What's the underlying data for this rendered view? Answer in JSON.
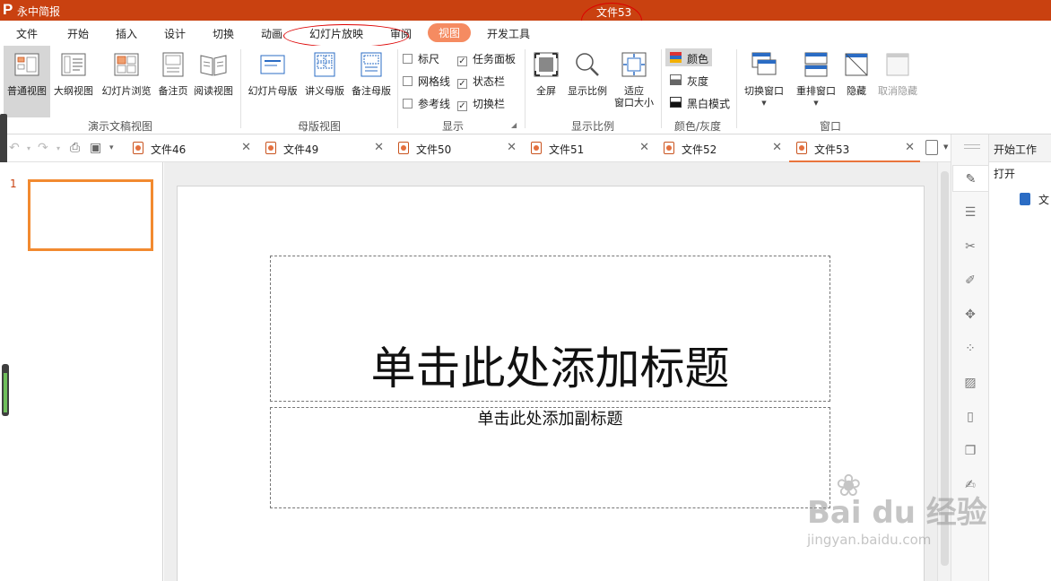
{
  "app": {
    "name": "永中简报",
    "logo_letter": "P",
    "document_title": "文件53"
  },
  "menu": [
    {
      "label": "文件",
      "name": "menu-file"
    },
    {
      "label": "开始",
      "name": "menu-home"
    },
    {
      "label": "插入",
      "name": "menu-insert"
    },
    {
      "label": "设计",
      "name": "menu-design"
    },
    {
      "label": "切换",
      "name": "menu-transition"
    },
    {
      "label": "动画",
      "name": "menu-animation"
    },
    {
      "label": "幻灯片放映",
      "name": "menu-slideshow"
    },
    {
      "label": "审阅",
      "name": "menu-review"
    },
    {
      "label": "视图",
      "name": "menu-view",
      "active": true
    },
    {
      "label": "开发工具",
      "name": "menu-developer"
    }
  ],
  "ribbon": {
    "presentation_views": {
      "label": "演示文稿视图",
      "buttons": [
        "普通视图",
        "大纲视图",
        "幻灯片浏览",
        "备注页",
        "阅读视图"
      ],
      "selected": "普通视图"
    },
    "master_views": {
      "label": "母版视图",
      "buttons": [
        "幻灯片母版",
        "讲义母版",
        "备注母版"
      ]
    },
    "show": {
      "label": "显示",
      "checkboxes": [
        {
          "label": "标尺",
          "checked": false
        },
        {
          "label": "网格线",
          "checked": false
        },
        {
          "label": "参考线",
          "checked": false
        },
        {
          "label": "任务面板",
          "checked": true
        },
        {
          "label": "状态栏",
          "checked": true
        },
        {
          "label": "切换栏",
          "checked": true
        }
      ]
    },
    "zoom": {
      "label": "显示比例",
      "buttons": [
        "全屏",
        "显示比例",
        "适应",
        "窗口大小"
      ]
    },
    "color": {
      "label": "颜色/灰度",
      "items": [
        "颜色",
        "灰度",
        "黑白模式"
      ],
      "selected": "颜色"
    },
    "window": {
      "label": "窗口",
      "buttons": [
        "切换窗口",
        "重排窗口",
        "隐藏",
        "取消隐藏"
      ],
      "disabled": "取消隐藏"
    }
  },
  "tabs": [
    {
      "label": "文件46"
    },
    {
      "label": "文件49"
    },
    {
      "label": "文件50"
    },
    {
      "label": "文件51"
    },
    {
      "label": "文件52"
    },
    {
      "label": "文件53",
      "active": true
    }
  ],
  "thumbnails": {
    "slide_number": "1"
  },
  "slide": {
    "title_placeholder": "单击此处添加标题",
    "subtitle_placeholder": "单击此处添加副标题"
  },
  "side_panel": {
    "header": "开始工作",
    "open_label": "打开",
    "file_label": "文"
  },
  "watermark": {
    "brand": "Bai du 经验",
    "url": "jingyan.baidu.com"
  },
  "colors": {
    "title_bar": "#c94110",
    "active_menu": "#f58b61",
    "thumb_border": "#f28a30",
    "annotation": "#dd0000"
  }
}
